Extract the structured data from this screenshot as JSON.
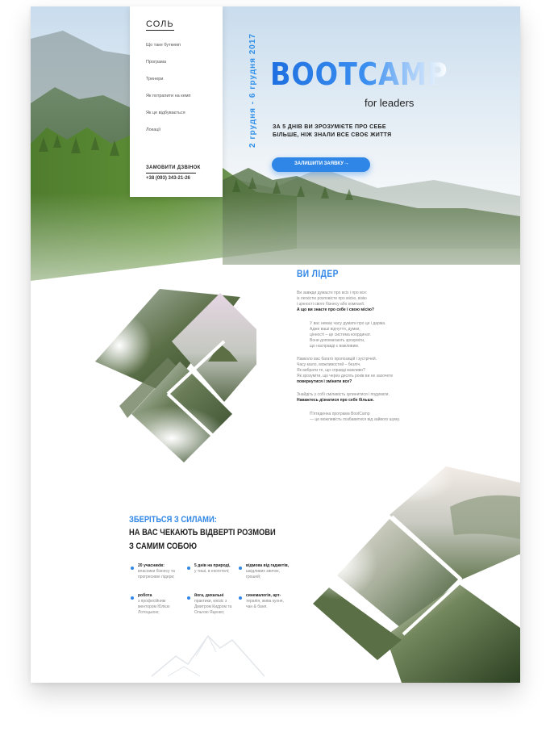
{
  "brand": {
    "logo": "СОЛЬ"
  },
  "menu": {
    "items": [
      {
        "label": "Що таке буткемп"
      },
      {
        "label": "Програма"
      },
      {
        "label": "Тренери"
      },
      {
        "label": "Як потрапити на кемп"
      },
      {
        "label": "Як це відбувається"
      },
      {
        "label": "Локації"
      }
    ],
    "order_call": "ЗАМОВИТИ ДЗВІНОК",
    "phone": "+38 (093) 343-21-26"
  },
  "hero": {
    "date": "2 грудня - 6 грудня 2017",
    "title": "BOOTCAMP",
    "subtitle": "for leaders",
    "lead_line1": "ЗА 5 ДНІВ ВИ ЗРОЗУМІЄТЕ ПРО СЕБЕ",
    "lead_line2": "БІЛЬШЕ, НІЖ ЗНАЛИ ВСЕ СВОЄ ЖИТТЯ",
    "cta_label": "ЗАЛИШИТИ ЗАЯВКУ",
    "cta_arrow": "→"
  },
  "leader": {
    "title": "ВИ ЛІДЕР",
    "p1": [
      "Ви завжди думаєте про всіх і про все:",
      "із легкістю розповісте про місію, візію",
      "і цінності свого бізнесу або компанії.",
      "А що ви знаєте про себе і свою місію?"
    ],
    "p2": [
      "У вас немає часу думати про це і дарма.",
      "Адже ваші відчуття, думки,",
      "цінності – це система координат.",
      "Вони допомагають зрозуміти,",
      "що насправді є важливим."
    ],
    "p3": [
      "Навколо вас багато пропозицій і зустрічей.",
      "Часу мало, можливостей – безліч.",
      "Як вибрати те, що справді важливо?",
      "Як зрозуміти, що через десять років ви не захочете",
      "повернутися і змінити все?"
    ],
    "p4": [
      "Знайдіть у собі сміливість зупинитися і подумати.",
      "Наважтесь дізнатися про себе більше."
    ],
    "p5": [
      "П'ятиденна програма BootCamp",
      "— це можливість позбавитися від зайвого шуму."
    ]
  },
  "gather": {
    "line1": "ЗБЕРІТЬСЯ З СИЛАМИ:",
    "line2": "НА ВАС ЧЕКАЮТЬ ВІДВЕРТІ РОЗМОВИ",
    "line3": "З САМИМ СОБОЮ",
    "features": [
      {
        "bold": "20 учасників:",
        "rest": [
          "власники бізнесу та",
          "прогресивні лідери;"
        ]
      },
      {
        "bold": "5 днів на природі,",
        "rest": [
          "у тиші, в екоготелі;"
        ]
      },
      {
        "bold": "відмова від гаджетів,",
        "rest": [
          "шкідливих звичок,",
          "грошей;"
        ]
      },
      {
        "bold": "робота",
        "rest": [
          "з професійним",
          "ментором Юлією",
          "Лотоцькою;"
        ]
      },
      {
        "bold": "йога, дихальні",
        "rest": [
          "практики, кінізіс з",
          "Дмитром Кидром та",
          "Ольгою Яценко;"
        ]
      },
      {
        "bold": "синемалогія, арт-",
        "rest": [
          "терапія, жива кухня,",
          "чан & баня."
        ]
      }
    ]
  },
  "colors": {
    "accent": "#2f86e6",
    "text": "#222222",
    "muted": "#888888"
  }
}
